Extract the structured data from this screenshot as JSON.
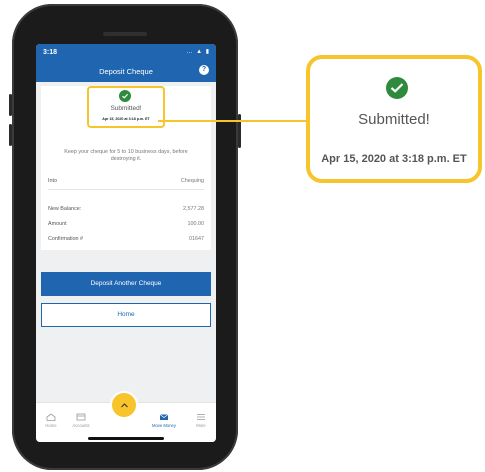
{
  "status_bar": {
    "time": "3:18",
    "icons": "… ▲ ▮"
  },
  "header": {
    "title": "Deposit Cheque",
    "help_icon": "?"
  },
  "receipt": {
    "status": "Submitted!",
    "timestamp": "Apr 15, 2020 at 3:18 p.m. ET",
    "instruction": "Keep your cheque for 5 to 10 business days, before destroying it.",
    "rows": [
      {
        "label": "Into",
        "value": "Chequing"
      },
      {
        "label": "New Balance:",
        "value": "2,577.28"
      },
      {
        "label": "Amount",
        "value": "100.00"
      },
      {
        "label": "Confirmation #",
        "value": "01647"
      }
    ]
  },
  "buttons": {
    "deposit_another": "Deposit Another Cheque",
    "home": "Home"
  },
  "nav": {
    "items": [
      {
        "label": "Home",
        "icon": "home-icon"
      },
      {
        "label": "Accounts",
        "icon": "accounts-icon"
      },
      {
        "label": "Move Money",
        "icon": "move-money-icon"
      },
      {
        "label": "More",
        "icon": "more-icon"
      }
    ],
    "fab_icon": "chevron-up-icon"
  },
  "callout": {
    "status": "Submitted!",
    "timestamp": "Apr 15, 2020 at 3:18 p.m. ET"
  },
  "colors": {
    "brand_blue": "#1f65b0",
    "highlight_yellow": "#f7c42b",
    "success_green": "#2e8b3e"
  }
}
